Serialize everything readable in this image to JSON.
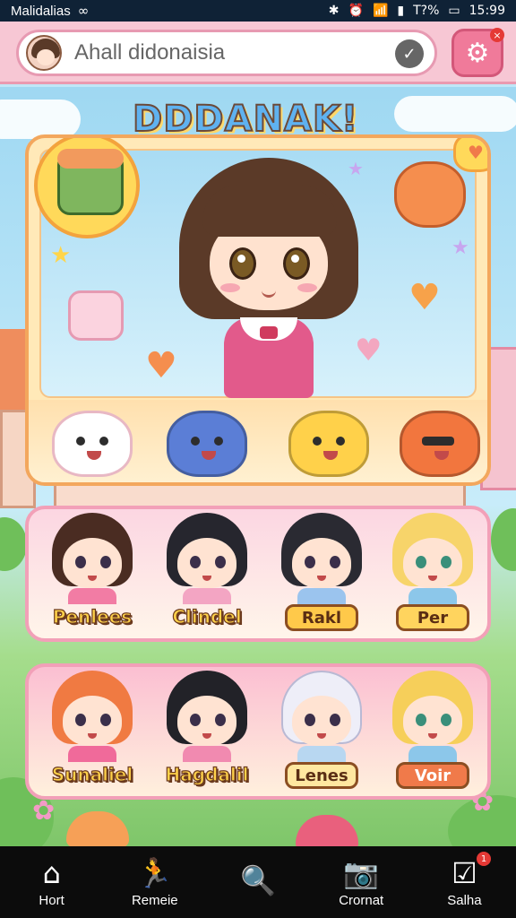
{
  "status_bar": {
    "carrier": "Malidalias",
    "battery": "T?%",
    "time": "15:99"
  },
  "search": {
    "value": "Ahall didonaisia"
  },
  "title": "DDDANAK!",
  "row1": [
    {
      "name": "Penlees",
      "style": "text"
    },
    {
      "name": "Clindel",
      "style": "text"
    },
    {
      "name": "Rakl",
      "style": "button",
      "color": "#ffc94a"
    },
    {
      "name": "Per",
      "style": "button",
      "color": "#ffd45e"
    }
  ],
  "row2": [
    {
      "name": "Sunaliel",
      "style": "text"
    },
    {
      "name": "Hagdalil",
      "style": "text"
    },
    {
      "name": "Lenes",
      "style": "button",
      "color": "#ffe7a0"
    },
    {
      "name": "Voir",
      "style": "button",
      "color": "#f07a4a"
    }
  ],
  "nav": [
    {
      "label": "Hort",
      "icon": "home-icon"
    },
    {
      "label": "Remeie",
      "icon": "run-icon"
    },
    {
      "label": "",
      "icon": "search-icon"
    },
    {
      "label": "Crornat",
      "icon": "camera-icon"
    },
    {
      "label": "Salha",
      "icon": "checkbox-icon",
      "badge": "1"
    }
  ],
  "colors": {
    "accent": "#f07a9a",
    "card_border": "#f3a75d",
    "row_border": "#f2a0b8"
  }
}
